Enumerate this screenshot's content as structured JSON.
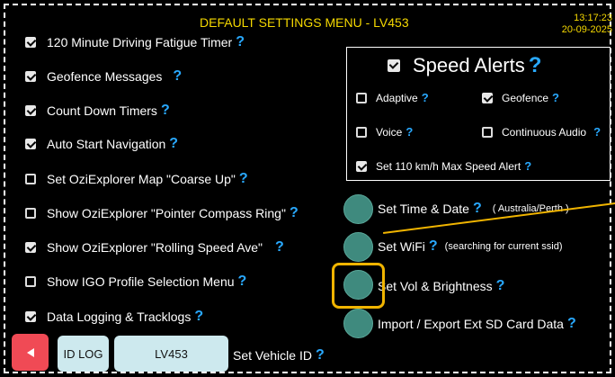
{
  "header": {
    "title": "DEFAULT SETTINGS MENU - LV453",
    "time": "13:17:23",
    "date": "20-09-2025"
  },
  "help_glyph": "?",
  "settings": [
    {
      "label": "120 Minute Driving Fatigue Timer",
      "checked": true
    },
    {
      "label": "Geofence Messages",
      "checked": true
    },
    {
      "label": "Count Down Timers",
      "checked": true
    },
    {
      "label": "Auto Start Navigation",
      "checked": true
    },
    {
      "label": "Set OziExplorer Map \"Coarse Up\"",
      "checked": false
    },
    {
      "label": "Show OziExplorer \"Pointer Compass Ring\"",
      "checked": false
    },
    {
      "label": "Show OziExplorer \"Rolling Speed Ave\"",
      "checked": true
    },
    {
      "label": "Show IGO Profile Selection Menu",
      "checked": false
    },
    {
      "label": "Data Logging & Tracklogs",
      "checked": true
    }
  ],
  "speed_alerts": {
    "title": "Speed Alerts",
    "checked": true,
    "options": [
      {
        "label": "Adaptive",
        "checked": false
      },
      {
        "label": "Geofence",
        "checked": true
      },
      {
        "label": "Voice",
        "checked": false
      },
      {
        "label": "Continuous Audio",
        "checked": false
      },
      {
        "label": "Set 110 km/h Max Speed Alert",
        "checked": true
      }
    ]
  },
  "actions": [
    {
      "label": "Set Time & Date",
      "note": "( Australia/Perth )"
    },
    {
      "label": "Set WiFi",
      "note": "(searching for current ssid)"
    },
    {
      "label": "Set Vol & Brightness",
      "note": ""
    },
    {
      "label": "Import / Export Ext SD Card Data",
      "note": ""
    }
  ],
  "footer": {
    "back_icon": "left-triangle-icon",
    "id_log_label": "ID LOG",
    "vehicle_id": "LV453",
    "set_vehicle_label": "Set Vehicle ID"
  },
  "colors": {
    "title": "#f5d800",
    "help": "#29a9ff",
    "highlight": "#f0b400",
    "action_circle": "#3f8a7e",
    "back_button": "#f04a55",
    "id_buttons": "#cde9ee"
  }
}
